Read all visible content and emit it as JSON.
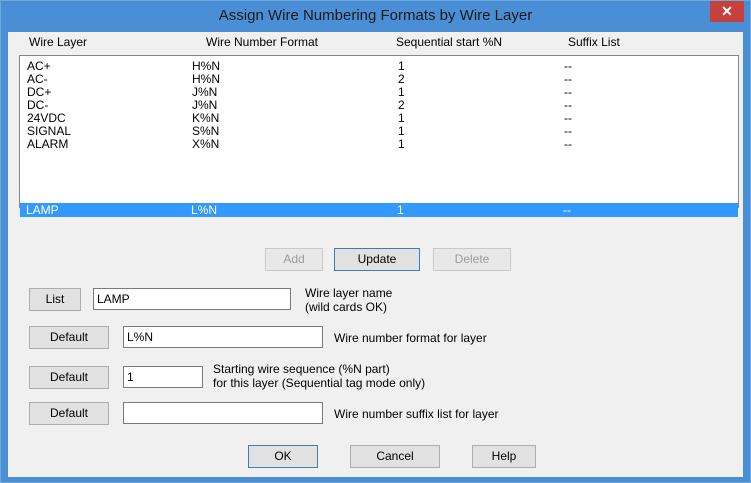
{
  "window": {
    "title": "Assign Wire Numbering Formats by Wire Layer",
    "close_glyph": "✕"
  },
  "table": {
    "headers": [
      "Wire Layer",
      "Wire Number Format",
      "Sequential start %N",
      "Suffix List"
    ],
    "rows": [
      [
        "AC+",
        "H%N",
        "1",
        "--"
      ],
      [
        "AC-",
        "H%N",
        "2",
        "--"
      ],
      [
        "DC+",
        "J%N",
        "1",
        "--"
      ],
      [
        "DC-",
        "J%N",
        "2",
        "--"
      ],
      [
        "24VDC",
        "K%N",
        "1",
        "--"
      ],
      [
        "SIGNAL",
        "S%N",
        "1",
        "--"
      ],
      [
        "ALARM",
        "X%N",
        "1",
        "--"
      ],
      [
        "LAMP",
        "L%N",
        "1",
        "--"
      ]
    ],
    "selected_row": "LAMP"
  },
  "actions": {
    "add": "Add",
    "update": "Update",
    "delete": "Delete"
  },
  "fields": {
    "layer": {
      "button": "List",
      "value": "LAMP",
      "label1": "Wire layer name",
      "label2": "(wild cards OK)"
    },
    "format": {
      "button": "Default",
      "value": "L%N",
      "label": "Wire number format for layer"
    },
    "sequence": {
      "button": "Default",
      "value": "1",
      "label1": "Starting wire sequence (%N part)",
      "label2": "for this layer (Sequential tag mode only)"
    },
    "suffix": {
      "button": "Default",
      "value": "",
      "label": "Wire number suffix list for layer"
    }
  },
  "footer": {
    "ok": "OK",
    "cancel": "Cancel",
    "help": "Help"
  }
}
